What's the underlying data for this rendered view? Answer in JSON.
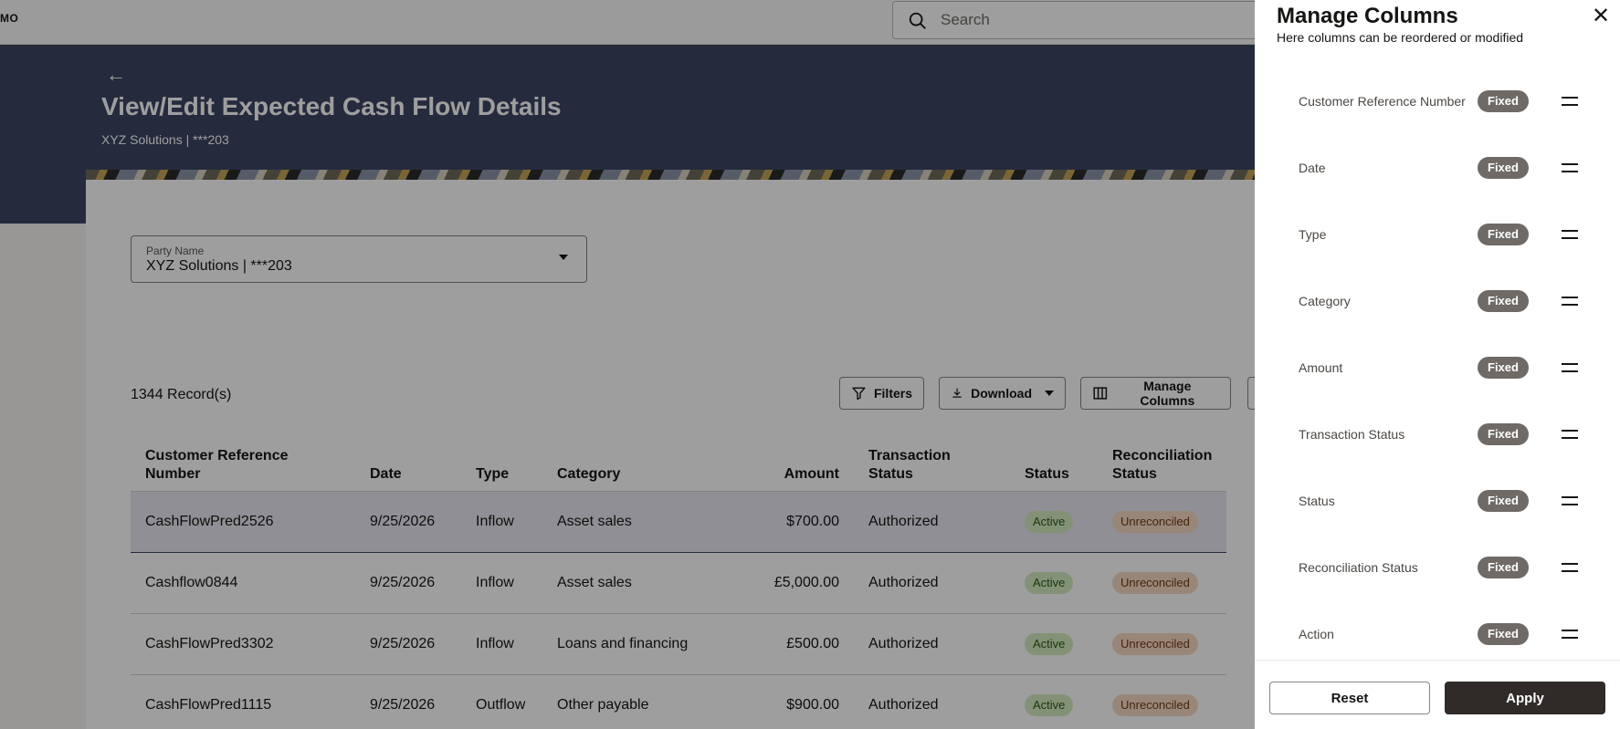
{
  "topbar": {
    "brand": "MO",
    "search_placeholder": "Search"
  },
  "hero": {
    "back_arrow": "←",
    "title": "View/Edit Expected Cash Flow Details",
    "subtitle": "XYZ Solutions | ***203"
  },
  "party": {
    "label": "Party Name",
    "value": "XYZ Solutions | ***203"
  },
  "toolbar": {
    "records": "1344 Record(s)",
    "filters": "Filters",
    "download": "Download",
    "manage_columns": "Manage Columns"
  },
  "table": {
    "headers": {
      "ref": "Customer Reference Number",
      "date": "Date",
      "type": "Type",
      "category": "Category",
      "amount": "Amount",
      "txn_status": "Transaction Status",
      "status": "Status",
      "recon": "Reconciliation Status"
    },
    "rows": [
      {
        "ref": "CashFlowPred2526",
        "date": "9/25/2026",
        "type": "Inflow",
        "category": "Asset sales",
        "amount": "$700.00",
        "txn_status": "Authorized",
        "status": "Active",
        "recon": "Unreconciled"
      },
      {
        "ref": "Cashflow0844",
        "date": "9/25/2026",
        "type": "Inflow",
        "category": "Asset sales",
        "amount": "£5,000.00",
        "txn_status": "Authorized",
        "status": "Active",
        "recon": "Unreconciled"
      },
      {
        "ref": "CashFlowPred3302",
        "date": "9/25/2026",
        "type": "Inflow",
        "category": "Loans and financing",
        "amount": "£500.00",
        "txn_status": "Authorized",
        "status": "Active",
        "recon": "Unreconciled"
      },
      {
        "ref": "CashFlowPred1115",
        "date": "9/25/2026",
        "type": "Outflow",
        "category": "Other payable",
        "amount": "$900.00",
        "txn_status": "Authorized",
        "status": "Active",
        "recon": "Unreconciled"
      }
    ]
  },
  "panel": {
    "title": "Manage Columns",
    "subtitle": "Here columns can be reordered or modified",
    "close": "✕",
    "fixed_label": "Fixed",
    "columns": [
      "Customer Reference Number",
      "Date",
      "Type",
      "Category",
      "Amount",
      "Transaction Status",
      "Status",
      "Reconciliation Status",
      "Action"
    ],
    "reset": "Reset",
    "apply": "Apply"
  },
  "colors": {
    "hero": "#3c4663",
    "apply_button": "#302b28",
    "fixed_badge": "#6f6a66",
    "active_badge": "#d3ecbf",
    "unreconciled_badge": "#f6d9c3"
  }
}
